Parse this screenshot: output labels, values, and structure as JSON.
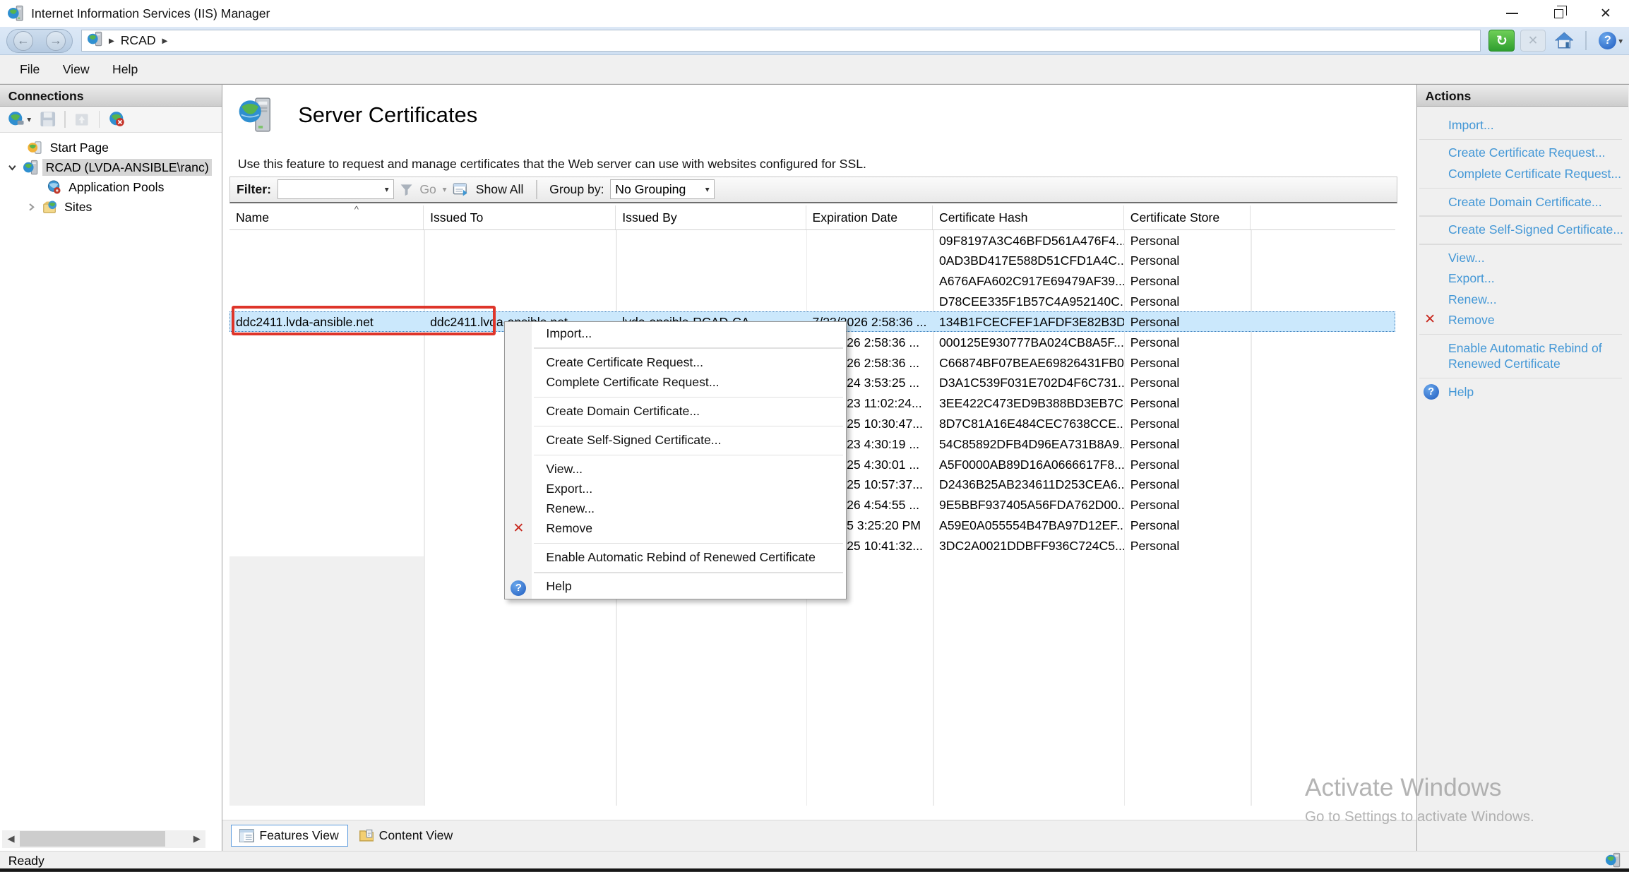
{
  "window": {
    "title": "Internet Information Services (IIS) Manager"
  },
  "address_bar": {
    "breadcrumb": [
      "RCAD"
    ]
  },
  "menu_bar": {
    "items": [
      {
        "label": "File"
      },
      {
        "label": "View"
      },
      {
        "label": "Help"
      }
    ]
  },
  "connections": {
    "title": "Connections",
    "tree": [
      {
        "label": "Start Page"
      },
      {
        "label": "RCAD (LVDA-ANSIBLE\\ranc)",
        "selected": true
      },
      {
        "label": "Application Pools"
      },
      {
        "label": "Sites"
      }
    ]
  },
  "main": {
    "title": "Server Certificates",
    "description": "Use this feature to request and manage certificates that the Web server can use with websites configured for SSL.",
    "filter": {
      "label": "Filter:",
      "filter_value": "",
      "go_label": "Go",
      "show_all_label": "Show All",
      "group_by_label": "Group by:",
      "group_by_value": "No Grouping"
    },
    "table": {
      "columns": [
        "Name",
        "Issued To",
        "Issued By",
        "Expiration Date",
        "Certificate Hash",
        "Certificate Store"
      ],
      "rows": [
        {
          "name": "",
          "issued_to": "",
          "issued_by": "",
          "expiration": "",
          "hash": "09F8197A3C46BFD561A476F4...",
          "store": "Personal"
        },
        {
          "name": "",
          "issued_to": "",
          "issued_by": "",
          "expiration": "",
          "hash": "0AD3BD417E588D51CFD1A4C...",
          "store": "Personal"
        },
        {
          "name": "",
          "issued_to": "",
          "issued_by": "",
          "expiration": "",
          "hash": "A676AFA602C917E69479AF39...",
          "store": "Personal"
        },
        {
          "name": "",
          "issued_to": "",
          "issued_by": "",
          "expiration": "",
          "hash": "D78CEE335F1B57C4A952140C...",
          "store": "Personal"
        },
        {
          "name": "ddc2411.lvda-ansible.net",
          "issued_to": "ddc2411.lvda-ansible.net",
          "issued_by": "lvda-ansible-RCAD-CA",
          "expiration": "7/23/2026 2:58:36 ...",
          "hash": "134B1FCECFEF1AFDF3E82B3D...",
          "store": "Personal",
          "selected": true
        },
        {
          "name": "",
          "issued_to": "",
          "issued_by": "",
          "expiration": "26 2:58:36 ...",
          "hash": "000125E930777BA024CB8A5F...",
          "store": "Personal"
        },
        {
          "name": "",
          "issued_to": "",
          "issued_by": "",
          "expiration": "26 2:58:36 ...",
          "hash": "C66874BF07BEAE69826431FB0...",
          "store": "Personal"
        },
        {
          "name": "",
          "issued_to": "",
          "issued_by": "",
          "expiration": "24 3:53:25 ...",
          "hash": "D3A1C539F031E702D4F6C731...",
          "store": "Personal"
        },
        {
          "name": "",
          "issued_to": "",
          "issued_by": "",
          "expiration": "23 11:02:24...",
          "hash": "3EE422C473ED9B388BD3EB7C...",
          "store": "Personal"
        },
        {
          "name": "",
          "issued_to": "",
          "issued_by": "",
          "expiration": "25 10:30:47...",
          "hash": "8D7C81A16E484CEC7638CCE...",
          "store": "Personal"
        },
        {
          "name": "",
          "issued_to": "",
          "issued_by": "",
          "expiration": "23 4:30:19 ...",
          "hash": "54C85892DFB4D96EA731B8A9...",
          "store": "Personal"
        },
        {
          "name": "",
          "issued_to": "",
          "issued_by": "",
          "expiration": "25 4:30:01 ...",
          "hash": "A5F0000AB89D16A0666617F8...",
          "store": "Personal"
        },
        {
          "name": "",
          "issued_to": "",
          "issued_by": "",
          "expiration": "25 10:57:37...",
          "hash": "D2436B25AB234611D253CEA6...",
          "store": "Personal"
        },
        {
          "name": "",
          "issued_to": "",
          "issued_by": "",
          "expiration": "26 4:54:55 ...",
          "hash": "9E5BBF937405A56FDA762D00...",
          "store": "Personal"
        },
        {
          "name": "",
          "issued_to": "",
          "issued_by": "",
          "expiration": "5 3:25:20 PM",
          "hash": "A59E0A055554B47BA97D12EF...",
          "store": "Personal"
        },
        {
          "name": "",
          "issued_to": "",
          "issued_by": "",
          "expiration": "25 10:41:32...",
          "hash": "3DC2A0021DDBFF936C724C5...",
          "store": "Personal"
        }
      ]
    },
    "tabs": [
      {
        "label": "Features View",
        "active": true
      },
      {
        "label": "Content View",
        "active": false
      }
    ]
  },
  "context_menu": {
    "items": [
      {
        "label": "Import..."
      },
      {
        "type": "separator"
      },
      {
        "label": "Create Certificate Request..."
      },
      {
        "label": "Complete Certificate Request..."
      },
      {
        "type": "separator"
      },
      {
        "label": "Create Domain Certificate..."
      },
      {
        "type": "separator"
      },
      {
        "label": "Create Self-Signed Certificate..."
      },
      {
        "type": "separator"
      },
      {
        "label": "View..."
      },
      {
        "label": "Export..."
      },
      {
        "label": "Renew..."
      },
      {
        "label": "Remove",
        "icon": "remove-icon"
      },
      {
        "type": "separator"
      },
      {
        "label": "Enable Automatic Rebind of Renewed Certificate"
      },
      {
        "type": "separator"
      },
      {
        "label": "Help",
        "icon": "help-icon"
      }
    ]
  },
  "actions": {
    "title": "Actions",
    "groups": [
      [
        {
          "label": "Import..."
        }
      ],
      [
        {
          "label": "Create Certificate Request..."
        },
        {
          "label": "Complete Certificate Request..."
        }
      ],
      [
        {
          "label": "Create Domain Certificate..."
        }
      ],
      [
        {
          "label": "Create Self-Signed Certificate..."
        }
      ],
      [
        {
          "label": "View..."
        },
        {
          "label": "Export..."
        },
        {
          "label": "Renew..."
        },
        {
          "label": "Remove",
          "icon": "remove-icon"
        }
      ],
      [
        {
          "label": "Enable Automatic Rebind of Renewed Certificate",
          "wrap": true
        }
      ],
      [
        {
          "label": "Help",
          "icon": "help-icon"
        }
      ]
    ]
  },
  "status_bar": {
    "text": "Ready"
  },
  "watermark": {
    "line1": "Activate Windows",
    "line2": "Go to Settings to activate Windows."
  },
  "colors": {
    "action_link": "#4397d6",
    "selection_bg": "#cbe8fc",
    "annotation_red": "#de352a",
    "address_bar": "#d5e3f3"
  }
}
